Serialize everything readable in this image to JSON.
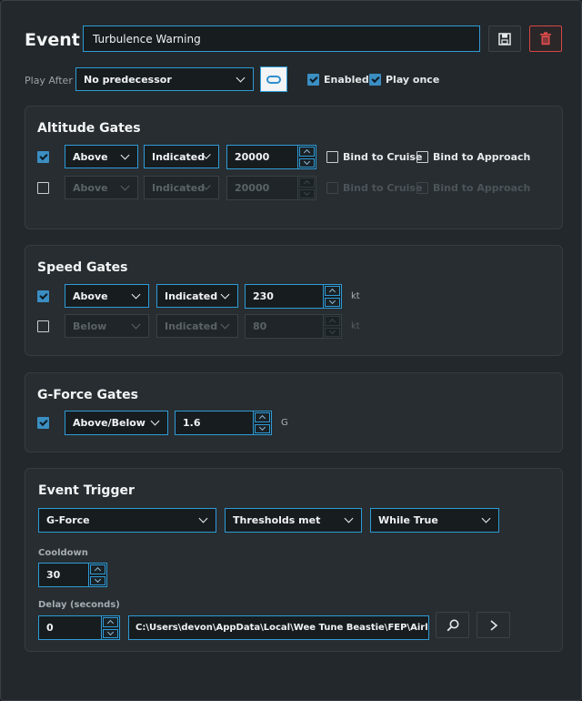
{
  "event": {
    "title": "Event",
    "name_value": "Turbulence Warning",
    "play_after_label": "Play After",
    "predecessor_select": "No predecessor",
    "enabled_label": "Enabled",
    "enabled_checked": true,
    "play_once_label": "Play once",
    "play_once_checked": true
  },
  "altitude": {
    "title": "Altitude Gates",
    "rows": [
      {
        "checked": true,
        "enabled": true,
        "direction": "Above",
        "reference": "Indicated",
        "value": "20000",
        "bind_cruise": "Bind to Cruise",
        "bind_approach": "Bind to Approach"
      },
      {
        "checked": false,
        "enabled": false,
        "direction": "Above",
        "reference": "Indicated",
        "value": "20000",
        "bind_cruise": "Bind to Cruise",
        "bind_approach": "Bind to Approach"
      }
    ]
  },
  "speed": {
    "title": "Speed Gates",
    "rows": [
      {
        "checked": true,
        "enabled": true,
        "direction": "Above",
        "reference": "Indicated",
        "value": "230",
        "unit": "kt"
      },
      {
        "checked": false,
        "enabled": false,
        "direction": "Below",
        "reference": "Indicated",
        "value": "80",
        "unit": "kt"
      }
    ]
  },
  "gforce": {
    "title": "G-Force Gates",
    "row": {
      "checked": true,
      "mode": "Above/Below",
      "value": "1.6",
      "unit": "G"
    }
  },
  "trigger": {
    "title": "Event Trigger",
    "source": "G-Force",
    "condition": "Thresholds met",
    "mode": "While True",
    "cooldown_label": "Cooldown",
    "cooldown_value": "30",
    "delay_label": "Delay (seconds)",
    "delay_value": "0",
    "file_path": "C:\\Users\\devon\\AppData\\Local\\Wee Tune Beastie\\FEP\\Airliner Fli"
  },
  "colors": {
    "accent": "#2f9bd6",
    "danger": "#d54747",
    "panel": "#272d31",
    "background": "#22282b"
  },
  "icons": [
    "save-icon",
    "trash-icon",
    "link-icon",
    "chevron-down-icon",
    "search-icon",
    "play-icon"
  ]
}
